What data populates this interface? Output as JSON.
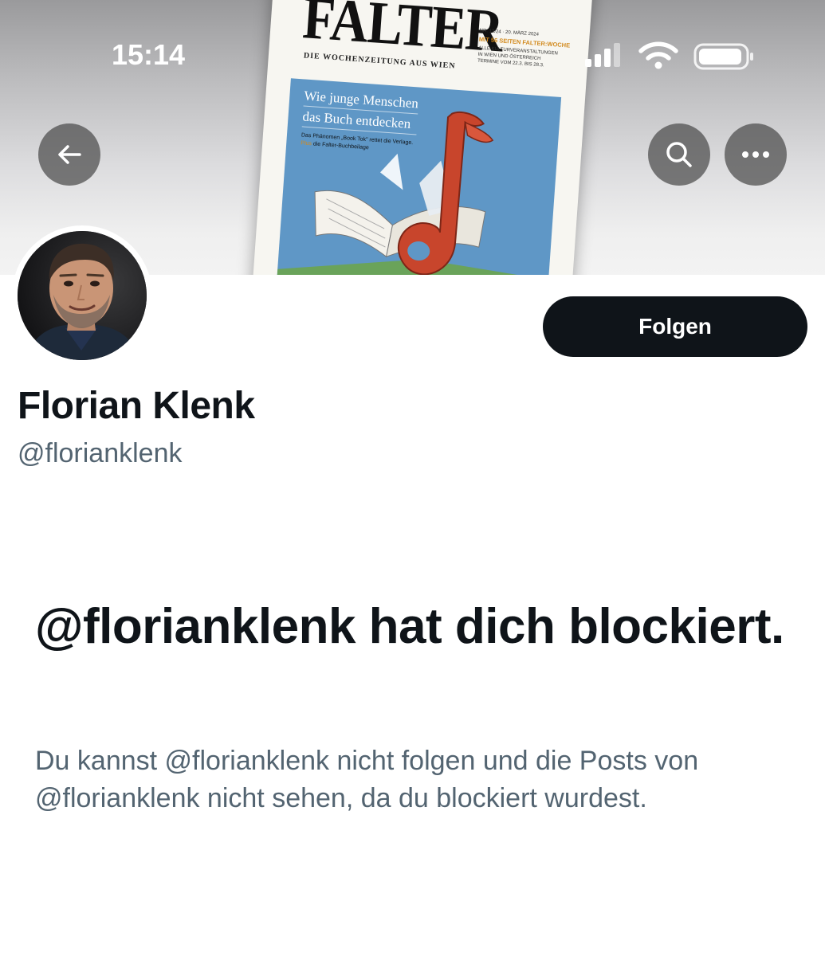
{
  "status_bar": {
    "time": "15:14",
    "icons": [
      "cellular-signal-icon",
      "wifi-icon",
      "battery-icon"
    ]
  },
  "banner": {
    "magazine_title": "FALTER",
    "magazine_subtitle": "DIE WOCHENZEITUNG AUS WIEN",
    "issue_line": "NR. 12/24 · 20. MÄRZ 2024",
    "feature_line": "MIT 56 SEITEN FALTER:WOCHE",
    "meta_lines": [
      "ALLE KULTURVERANSTALTUNGEN",
      "IN WIEN UND ÖSTERREICH",
      "TERMINE VOM 22.3. BIS 28.3."
    ],
    "headline_1": "Wie junge Menschen",
    "headline_2": "das Buch entdecken",
    "tease_1": "Das Phänomen „Book Tok\" rettet die Verlage.",
    "tease_prefix": "Plus",
    "tease_2": "die Falter-Buchbeilage"
  },
  "nav": {
    "back_icon": "arrow-left-icon",
    "search_icon": "search-icon",
    "more_icon": "more-horizontal-icon"
  },
  "profile": {
    "display_name": "Florian Klenk",
    "handle": "@florianklenk",
    "follow_label": "Folgen"
  },
  "blocked": {
    "title": "@florianklenk hat dich blockiert.",
    "message": "Du kannst @florianklenk nicht folgen und die Posts von @florianklenk nicht sehen, da du blockiert wurdest."
  },
  "colors": {
    "text_primary": "#0f1419",
    "text_secondary": "#536471",
    "button_dark": "#0f1419",
    "magazine_blue": "#5f97c6",
    "tiktok_note_red": "#c8452c",
    "magazine_orange": "#d28a1e"
  }
}
